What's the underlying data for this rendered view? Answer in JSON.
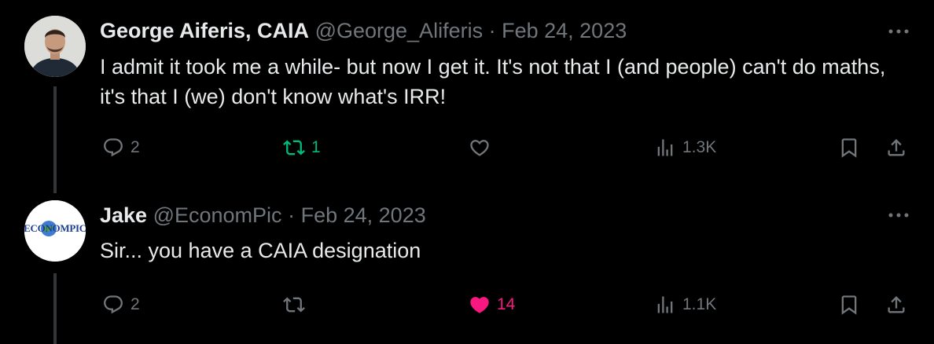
{
  "tweets": [
    {
      "author": {
        "name": "George Aiferis, CAIA",
        "handle": "@George_Aliferis"
      },
      "separator": "·",
      "date": "Feb 24, 2023",
      "text": "I admit it took me a while-  but now I get it. It's not that I (and people) can't do maths, it's that I (we) don't know what's IRR!",
      "stats": {
        "replies": "2",
        "retweets": "1",
        "likes": "",
        "views": "1.3K"
      },
      "retweeted": true,
      "liked": false
    },
    {
      "author": {
        "name": "Jake",
        "handle": "@EconomPic",
        "avatar_text": "ECONOMPIC"
      },
      "separator": "·",
      "date": "Feb 24, 2023",
      "text": "Sir... you have a CAIA designation",
      "stats": {
        "replies": "2",
        "retweets": "",
        "likes": "14",
        "views": "1.1K"
      },
      "retweeted": false,
      "liked": true
    }
  ],
  "colors": {
    "background": "#000000",
    "text": "#e7e9ea",
    "muted": "#71767b",
    "retweet_active": "#00ba7c",
    "like_active": "#f91880"
  },
  "icons": [
    "reply-icon",
    "retweet-icon",
    "like-icon",
    "views-icon",
    "bookmark-icon",
    "share-icon",
    "more-icon"
  ]
}
